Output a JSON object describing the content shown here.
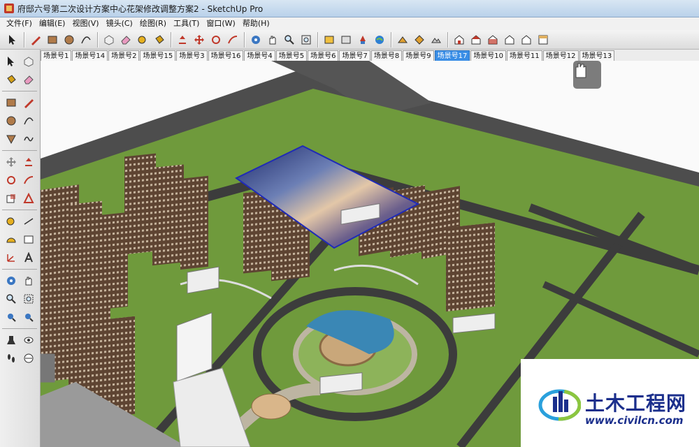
{
  "window": {
    "title": "府邸六号第二次设计方案中心花架修改调整方案2 - SketchUp Pro"
  },
  "menu": [
    "文件(F)",
    "编辑(E)",
    "视图(V)",
    "镜头(C)",
    "绘图(R)",
    "工具(T)",
    "窗口(W)",
    "帮助(H)"
  ],
  "toolbar_icons": [
    "select-icon",
    "pencil-line-icon",
    "rectangle-icon",
    "circle-icon",
    "arc-icon",
    "make-component-icon",
    "eraser-icon",
    "tape-measure-icon",
    "paint-bucket-icon",
    "push-pull-icon",
    "move-icon",
    "rotate-icon",
    "follow-me-icon",
    "orbit-icon",
    "pan-icon",
    "zoom-icon",
    "zoom-extents-icon",
    "get-models-icon",
    "share-model-icon",
    "components-icon",
    "google-earth-icon",
    "photo-textures-icon",
    "add-location-icon",
    "terrain-icon",
    "iso-view-icon",
    "top-view-icon",
    "front-view-icon",
    "right-view-icon",
    "back-view-icon",
    "left-view-icon"
  ],
  "left_toolbar_icons": [
    "select-icon",
    "make-component-icon",
    "paint-bucket-icon",
    "eraser-icon",
    "rectangle-icon",
    "line-icon",
    "circle-icon",
    "arc-icon",
    "polygon-icon",
    "freehand-icon",
    "move-icon",
    "push-pull-icon",
    "rotate-icon",
    "follow-me-icon",
    "scale-icon",
    "offset-icon",
    "tape-measure-icon",
    "dimension-icon",
    "protractor-icon",
    "text-icon",
    "axes-icon",
    "3d-text-icon",
    "orbit-icon",
    "pan-icon",
    "zoom-icon",
    "zoom-window-icon",
    "zoom-extents-icon",
    "previous-view-icon",
    "position-camera-icon",
    "look-around-icon",
    "walk-icon",
    "section-plane-icon"
  ],
  "scene_tabs": {
    "active_index": 11,
    "items": [
      "场景号1",
      "场景号14",
      "场景号2",
      "场景号15",
      "场景号3",
      "场景号16",
      "场景号4",
      "场景号5",
      "场景号6",
      "场景号7",
      "场景号8",
      "场景号9",
      "场景号17",
      "场景号10",
      "场景号11",
      "场景号12",
      "场景号13"
    ]
  },
  "colors": {
    "grass": "#6f9a3c",
    "road": "#4b4b4b",
    "path": "#bdb5a2",
    "building": "#7a5a42",
    "active_tab": "#3a8ee6"
  },
  "watermark": {
    "title": "土木工程网",
    "url": "www.civilcn.com"
  }
}
